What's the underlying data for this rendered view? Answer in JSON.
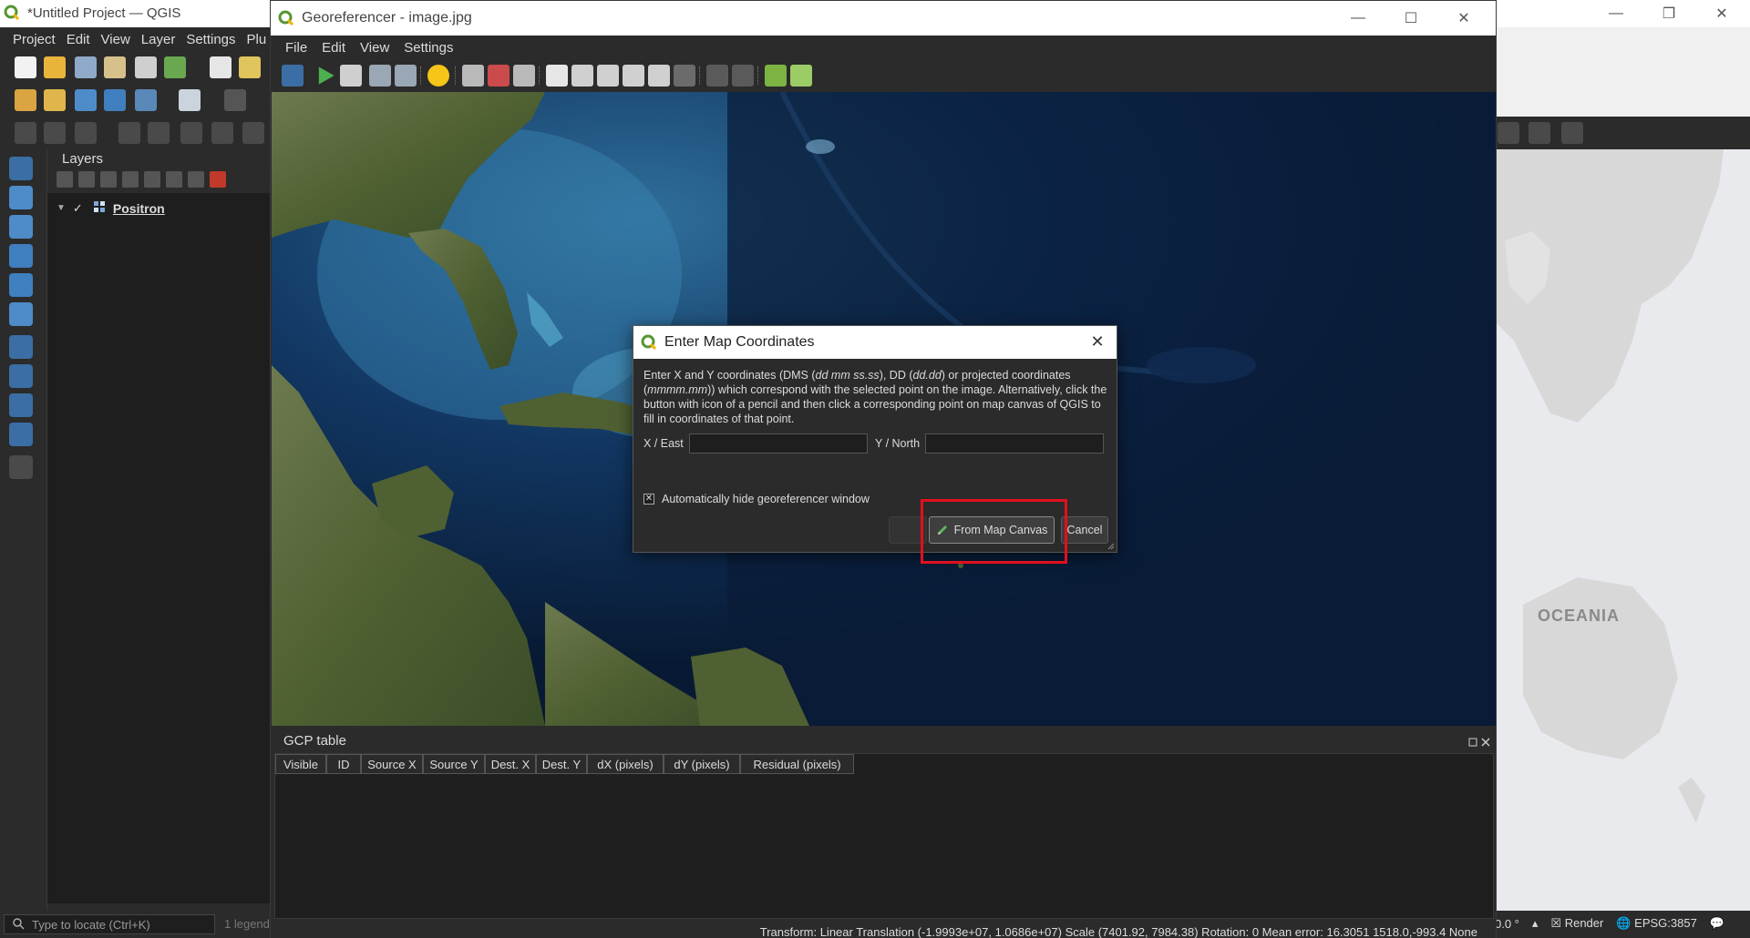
{
  "main_window": {
    "title": "*Untitled Project — QGIS",
    "menu": [
      "Project",
      "Edit",
      "View",
      "Layer",
      "Settings",
      "Plu"
    ],
    "layers_panel": {
      "title": "Layers",
      "layers": [
        {
          "name": "Positron",
          "visible": true
        }
      ]
    },
    "status": {
      "locate_placeholder": "Type to locate (Ctrl+K)",
      "legend_hint": "1 legend",
      "rotation": "0.0 °",
      "render": "Render",
      "crs": "EPSG:3857"
    },
    "map_label": "OCEANIA"
  },
  "georef_window": {
    "title": "Georeferencer - image.jpg",
    "menu": [
      "File",
      "Edit",
      "View",
      "Settings"
    ],
    "gcp_panel": {
      "title": "GCP table",
      "columns": [
        "Visible",
        "ID",
        "Source X",
        "Source Y",
        "Dest. X",
        "Dest. Y",
        "dX (pixels)",
        "dY (pixels)",
        "Residual (pixels)"
      ]
    },
    "status_text": "Transform: Linear Translation (-1.9993e+07, 1.0686e+07) Scale (7401.92, 7984.38) Rotation: 0 Mean error: 16.3051    1518.0,-993.4    None"
  },
  "dialog": {
    "title": "Enter Map Coordinates",
    "desc_1": "Enter X and Y coordinates (DMS (",
    "desc_dms": "dd mm ss.ss",
    "desc_2": "), DD (",
    "desc_dd": "dd.dd",
    "desc_3": ") or projected coordinates (",
    "desc_proj": "mmmm.mm",
    "desc_4": ")) which correspond with the selected point on the image. Alternatively, click the button with icon of a pencil and then click a corresponding point on map canvas of QGIS to fill in coordinates of that point.",
    "x_label": "X / East",
    "x_value": "",
    "y_label": "Y / North",
    "y_value": "",
    "autohide_label": "Automatically hide georeferencer window",
    "autohide_checked": true,
    "from_canvas_label": "From Map Canvas",
    "cancel_label": "Cancel"
  },
  "colors": {
    "highlight": "#e0101e",
    "qgis_green": "#589632",
    "dark_bg": "#2b2b2b"
  }
}
